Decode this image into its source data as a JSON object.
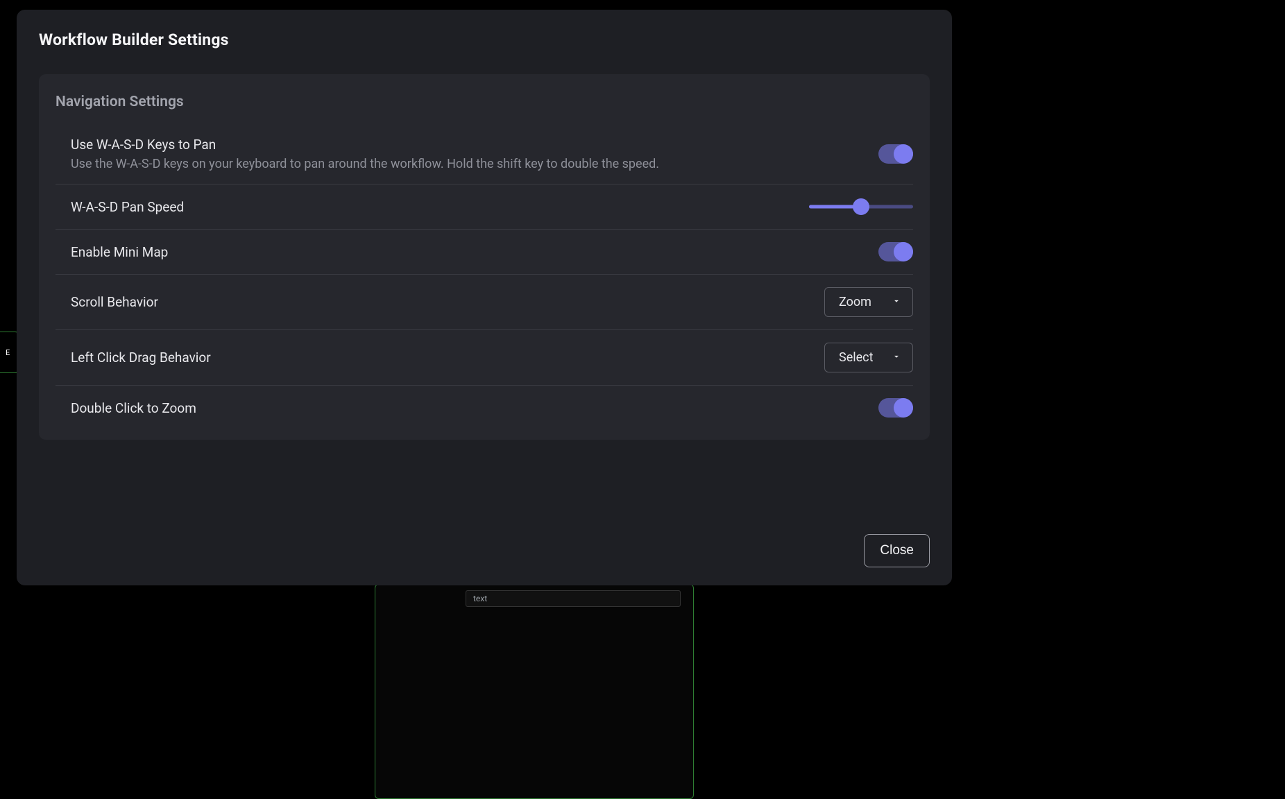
{
  "modal": {
    "title": "Workflow Builder Settings",
    "close_label": "Close"
  },
  "section": {
    "title": "Navigation Settings"
  },
  "rows": {
    "wasd": {
      "label": "Use W-A-S-D Keys to Pan",
      "desc": "Use the W-A-S-D keys on your keyboard to pan around the workflow. Hold the shift key to double the speed.",
      "toggle_on": true
    },
    "wasd_speed": {
      "label": "W-A-S-D Pan Speed",
      "slider_value_percent": 50
    },
    "mini_map": {
      "label": "Enable Mini Map",
      "toggle_on": true
    },
    "scroll_behavior": {
      "label": "Scroll Behavior",
      "value": "Zoom"
    },
    "left_click_drag": {
      "label": "Left Click Drag Behavior",
      "value": "Select"
    },
    "double_click_zoom": {
      "label": "Double Click to Zoom",
      "toggle_on": true
    }
  },
  "background": {
    "left_fragment": "E",
    "bottom_field": "text"
  },
  "colors": {
    "accent": "#7c7cf0",
    "panel": "#1e1f24",
    "section": "#26272d"
  }
}
